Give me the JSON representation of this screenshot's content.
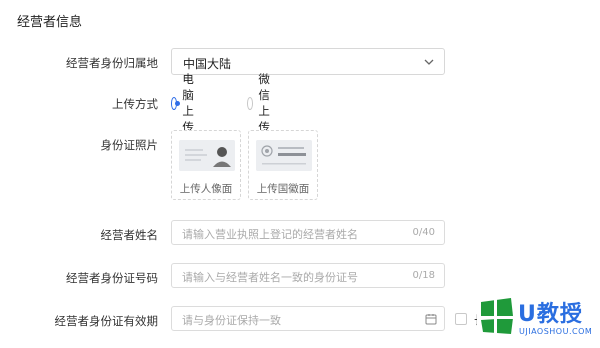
{
  "section": {
    "title": "经营者信息"
  },
  "region": {
    "label": "经营者身份归属地",
    "value": "中国大陆",
    "icon": "chevron-down-icon"
  },
  "upload_method": {
    "label": "上传方式",
    "options": [
      {
        "label": "电脑上传",
        "checked": true
      },
      {
        "label": "微信上传",
        "checked": false
      }
    ]
  },
  "id_photos": {
    "label": "身份证照片",
    "cards": [
      {
        "caption": "上传人像面",
        "icon": "id-portrait-icon"
      },
      {
        "caption": "上传国徽面",
        "icon": "id-emblem-icon"
      }
    ]
  },
  "name_field": {
    "label": "经营者姓名",
    "placeholder": "请输入营业执照上登记的经营者姓名",
    "counter": "0/40"
  },
  "id_number_field": {
    "label": "经营者身份证号码",
    "placeholder": "请输入与经营者姓名一致的身份证号",
    "counter": "0/18"
  },
  "validity_field": {
    "label": "经营者身份证有效期",
    "placeholder": "请与身份证保持一致",
    "icon": "calendar-icon"
  },
  "long_term": {
    "label": "长期",
    "checked": false
  },
  "watermark": {
    "text": "U教授",
    "sub": "UJIAOSHOU.COM",
    "colors": {
      "blue": "#2a6ee0",
      "green": "#1f9a3a"
    }
  }
}
